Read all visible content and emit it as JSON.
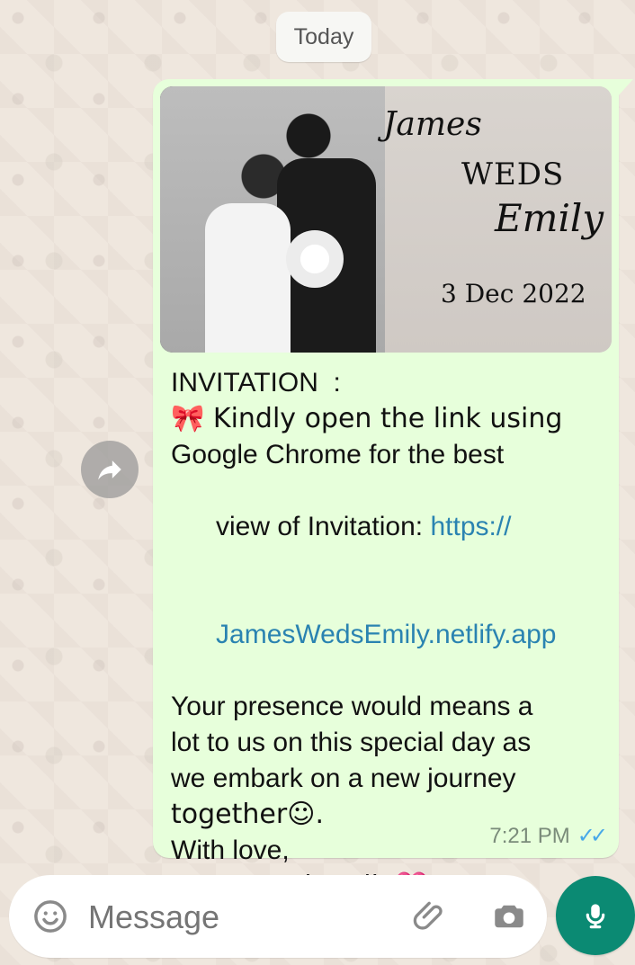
{
  "chat": {
    "date_separator": "Today"
  },
  "message": {
    "image_texts": {
      "name_top": "James",
      "middle": "WEDS",
      "name_bottom": "Emily",
      "date": "3 Dec 2022"
    },
    "lines": {
      "line1": "INVITATION  :",
      "line2": "🎀 Kindly open the link using",
      "line3": "Google Chrome for the best",
      "line4_prefix": "view of Invitation: ",
      "line4_link": "https://",
      "line5_link": "JamesWedsEmily.netlify.app",
      "line6": "Your presence would means a",
      "line7": "lot to us on this special day as",
      "line8": "we embark on a new journey",
      "line9": "together☺.",
      "line10": "With love,",
      "line11": "James and Emily💝"
    },
    "time": "7:21 PM",
    "status_ticks": "✓✓"
  },
  "composer": {
    "placeholder": "Message"
  },
  "icons": {
    "forward": "forward-icon",
    "emoji": "emoji-icon",
    "attach": "attach-icon",
    "camera": "camera-icon",
    "mic": "mic-icon"
  },
  "colors": {
    "bubble": "#e7ffdb",
    "link": "#2a83b1",
    "accent": "#0b8a73",
    "tick": "#47a9e8"
  }
}
